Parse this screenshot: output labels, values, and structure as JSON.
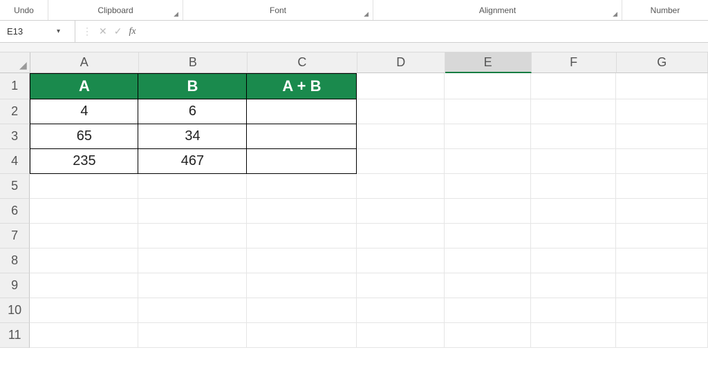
{
  "ribbon": {
    "groups": {
      "undo": "Undo",
      "clipboard": "Clipboard",
      "font": "Font",
      "alignment": "Alignment",
      "number": "Number"
    }
  },
  "namebox": {
    "value": "E13"
  },
  "formula_bar": {
    "fx_label": "fx",
    "value": ""
  },
  "columns": [
    "A",
    "B",
    "C",
    "D",
    "E",
    "F",
    "G"
  ],
  "rows": [
    "1",
    "2",
    "3",
    "4",
    "5",
    "6",
    "7",
    "8",
    "9",
    "10",
    "11"
  ],
  "selected_column": "E",
  "table": {
    "header": {
      "A": "A",
      "B": "B",
      "C": "A + B"
    },
    "data": [
      {
        "A": "4",
        "B": "6",
        "C": ""
      },
      {
        "A": "65",
        "B": "34",
        "C": ""
      },
      {
        "A": "235",
        "B": "467",
        "C": ""
      }
    ]
  },
  "chart_data": {
    "type": "table",
    "columns": [
      "A",
      "B",
      "A + B"
    ],
    "rows": [
      [
        4,
        6,
        null
      ],
      [
        65,
        34,
        null
      ],
      [
        235,
        467,
        null
      ]
    ]
  }
}
